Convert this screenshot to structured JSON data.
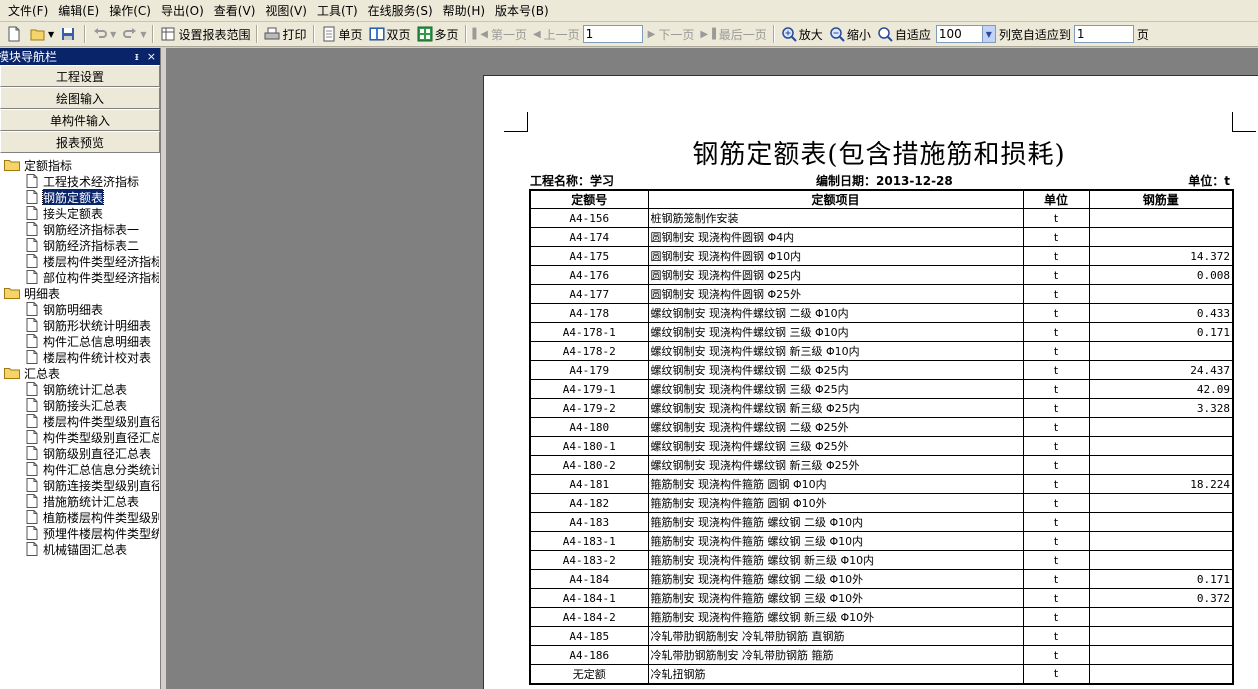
{
  "menu": [
    "文件(F)",
    "编辑(E)",
    "操作(C)",
    "导出(O)",
    "查看(V)",
    "视图(V)",
    "工具(T)",
    "在线服务(S)",
    "帮助(H)",
    "版本号(B)"
  ],
  "toolbar": {
    "set_range": "设置报表范围",
    "print": "打印",
    "single_page": "单页",
    "double_page": "双页",
    "multi_page": "多页",
    "first_page": "第一页",
    "prev_page": "上一页",
    "page_value": "1",
    "next_page": "下一页",
    "last_page": "最后一页",
    "zoom_in": "放大",
    "zoom_out": "缩小",
    "fit": "自适应",
    "zoom_value": "100",
    "col_fit": "列宽自适应到",
    "col_value": "1",
    "page_unit": "页"
  },
  "sidebar": {
    "title": "模块导航栏",
    "pin": "ᵻ",
    "close": "×",
    "nav_buttons": [
      "工程设置",
      "绘图输入",
      "单构件输入",
      "报表预览"
    ],
    "groups": [
      {
        "label": "定额指标",
        "items": [
          "工程技术经济指标",
          "钢筋定额表",
          "接头定额表",
          "钢筋经济指标表一",
          "钢筋经济指标表二",
          "楼层构件类型经济指标",
          "部位构件类型经济指标"
        ]
      },
      {
        "label": "明细表",
        "items": [
          "钢筋明细表",
          "钢筋形状统计明细表",
          "构件汇总信息明细表",
          "楼层构件统计校对表"
        ]
      },
      {
        "label": "汇总表",
        "items": [
          "钢筋统计汇总表",
          "钢筋接头汇总表",
          "楼层构件类型级别直径",
          "构件类型级别直径汇总",
          "钢筋级别直径汇总表",
          "构件汇总信息分类统计",
          "钢筋连接类型级别直径",
          "措施筋统计汇总表",
          "植筋楼层构件类型级别",
          "预埋件楼层构件类型统",
          "机械锚固汇总表"
        ]
      }
    ],
    "selected": "钢筋定额表"
  },
  "report": {
    "title": "钢筋定额表(包含措施筋和损耗)",
    "project_label": "工程名称：学习",
    "date_label": "编制日期：2013-12-28",
    "unit_label": "单位：t",
    "columns": [
      "定额号",
      "定额项目",
      "单位",
      "钢筋量"
    ],
    "rows": [
      [
        "A4-156",
        "桩钢筋笼制作安装",
        "t",
        ""
      ],
      [
        "A4-174",
        "圆钢制安 现浇构件圆钢 Φ4内",
        "t",
        ""
      ],
      [
        "A4-175",
        "圆钢制安 现浇构件圆钢 Φ10内",
        "t",
        "14.372"
      ],
      [
        "A4-176",
        "圆钢制安 现浇构件圆钢 Φ25内",
        "t",
        "0.008"
      ],
      [
        "A4-177",
        "圆钢制安 现浇构件圆钢 Φ25外",
        "t",
        ""
      ],
      [
        "A4-178",
        "螺纹钢制安 现浇构件螺纹钢 二级 Φ10内",
        "t",
        "0.433"
      ],
      [
        "A4-178-1",
        "螺纹钢制安 现浇构件螺纹钢 三级 Φ10内",
        "t",
        "0.171"
      ],
      [
        "A4-178-2",
        "螺纹钢制安 现浇构件螺纹钢 新三级 Φ10内",
        "t",
        ""
      ],
      [
        "A4-179",
        "螺纹钢制安 现浇构件螺纹钢 二级 Φ25内",
        "t",
        "24.437"
      ],
      [
        "A4-179-1",
        "螺纹钢制安 现浇构件螺纹钢 三级 Φ25内",
        "t",
        "42.09"
      ],
      [
        "A4-179-2",
        "螺纹钢制安 现浇构件螺纹钢 新三级 Φ25内",
        "t",
        "3.328"
      ],
      [
        "A4-180",
        "螺纹钢制安 现浇构件螺纹钢 二级 Φ25外",
        "t",
        ""
      ],
      [
        "A4-180-1",
        "螺纹钢制安 现浇构件螺纹钢 三级 Φ25外",
        "t",
        ""
      ],
      [
        "A4-180-2",
        "螺纹钢制安 现浇构件螺纹钢 新三级 Φ25外",
        "t",
        ""
      ],
      [
        "A4-181",
        "箍筋制安 现浇构件箍筋 圆钢 Φ10内",
        "t",
        "18.224"
      ],
      [
        "A4-182",
        "箍筋制安 现浇构件箍筋 圆钢 Φ10外",
        "t",
        ""
      ],
      [
        "A4-183",
        "箍筋制安 现浇构件箍筋 螺纹钢 二级 Φ10内",
        "t",
        ""
      ],
      [
        "A4-183-1",
        "箍筋制安 现浇构件箍筋 螺纹钢 三级 Φ10内",
        "t",
        ""
      ],
      [
        "A4-183-2",
        "箍筋制安 现浇构件箍筋 螺纹钢 新三级 Φ10内",
        "t",
        ""
      ],
      [
        "A4-184",
        "箍筋制安 现浇构件箍筋 螺纹钢 二级 Φ10外",
        "t",
        "0.171"
      ],
      [
        "A4-184-1",
        "箍筋制安 现浇构件箍筋 螺纹钢 三级 Φ10外",
        "t",
        "0.372"
      ],
      [
        "A4-184-2",
        "箍筋制安 现浇构件箍筋 螺纹钢 新三级 Φ10外",
        "t",
        ""
      ],
      [
        "A4-185",
        "冷轧带肋钢筋制安 冷轧带肋钢筋 直钢筋",
        "t",
        ""
      ],
      [
        "A4-186",
        "冷轧带肋钢筋制安 冷轧带肋钢筋 箍筋",
        "t",
        ""
      ],
      [
        "无定额",
        "冷轧扭钢筋",
        "t",
        ""
      ]
    ]
  },
  "colors": {
    "selection": "#0a246a",
    "chrome": "#ece9d8",
    "workspace": "#808080",
    "folder": "#f5d46a"
  }
}
